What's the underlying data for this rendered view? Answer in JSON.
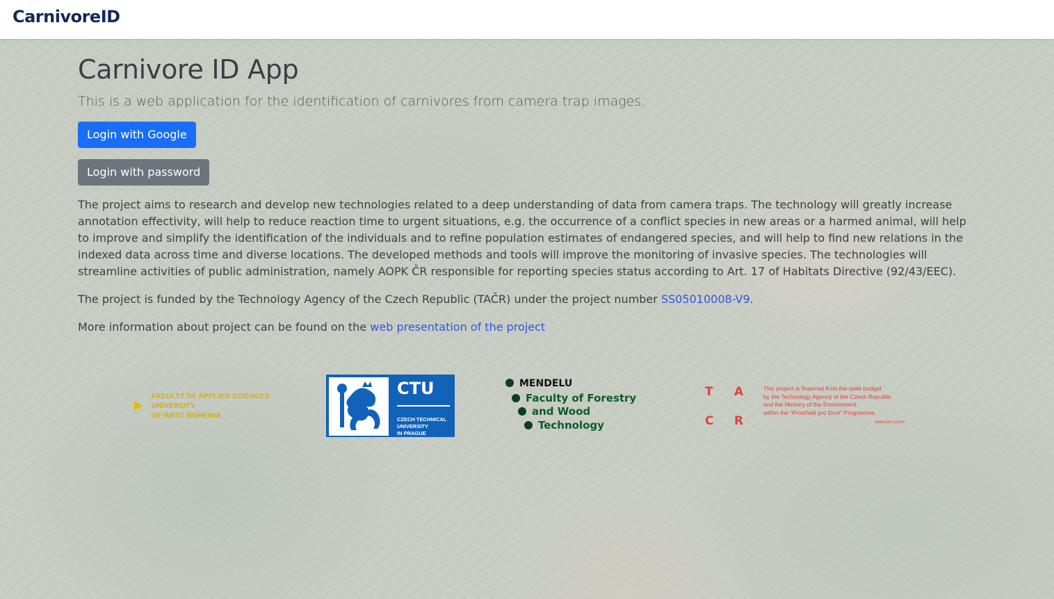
{
  "navbar": {
    "brand": "CarnivoreID"
  },
  "hero": {
    "title": "Carnivore ID App",
    "lead": "This is a web application for the identification of carnivores from camera trap images."
  },
  "buttons": {
    "google": "Login with Google",
    "password": "Login with password"
  },
  "description": "The project aims to research and develop new technologies related to a deep understanding of data from camera traps. The technology will greatly increase annotation effectivity, will help to reduce reaction time to urgent situations, e.g. the occurrence of a conflict species in new areas or a harmed animal, will help to improve and simplify the identification of the individuals and to refine population estimates of endangered species, and will help to find new relations in the indexed data across time and diverse locations. The developed methods and tools will improve the monitoring of invasive species. The technologies will streamline activities of public administration, namely AOPK ČR responsible for reporting species status according to Art. 17 of Habitats Directive (92/43/EEC).",
  "funding": {
    "prefix": "The project is funded by the Technology Agency of the Czech Republic (TAČR) under the project number ",
    "link": "SS05010008-V9",
    "suffix": "."
  },
  "more_info": {
    "prefix": "More information about project can be found on the ",
    "link": "web presentation of the project"
  },
  "logos": {
    "zcu": [
      "FACULTY OF APPLIED SCIENCES",
      "UNIVERSITY",
      "OF WEST BOHEMIA"
    ],
    "ctu": {
      "title": "CTU",
      "lines": [
        "CZECH TECHNICAL",
        "UNIVERSITY",
        "IN PRAGUE"
      ]
    },
    "mendelu": [
      "MENDELU",
      "Faculty of Forestry",
      "and Wood",
      "Technology"
    ],
    "tacr": {
      "letters": [
        "T",
        "A",
        "C",
        "R"
      ],
      "text": [
        "This project is financed from the state budget",
        "by the Technology Agency of the Czech Republic",
        "and the Ministry of the Environment",
        "within the \"Prostředí pro život\" Programme."
      ],
      "url": "www.tacr.cz/en"
    }
  },
  "colors": {
    "brand": "#13295b",
    "primary": "#1a6ef5",
    "secondary": "#6c757d",
    "link": "#2c56e0"
  }
}
